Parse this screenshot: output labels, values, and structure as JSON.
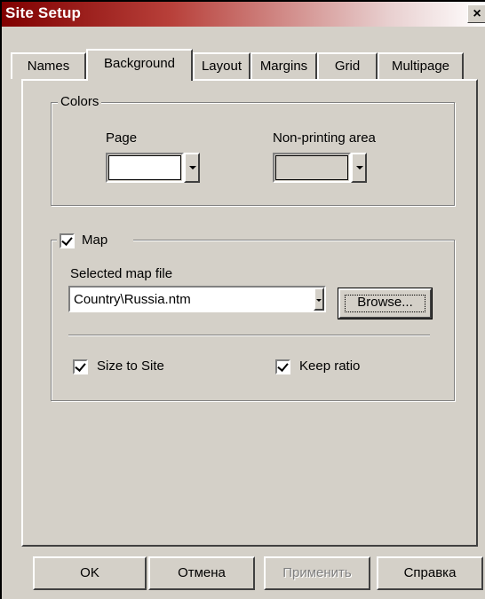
{
  "window": {
    "title": "Site Setup",
    "close_icon": "close-icon",
    "close_glyph": "×"
  },
  "tabs": [
    {
      "label": "Names",
      "active": false
    },
    {
      "label": "Background",
      "active": true
    },
    {
      "label": "Layout",
      "active": false
    },
    {
      "label": "Margins",
      "active": false
    },
    {
      "label": "Grid",
      "active": false
    },
    {
      "label": "Multipage",
      "active": false
    }
  ],
  "colors_group": {
    "title": "Colors",
    "page_label": "Page",
    "page_color": "#ffffff",
    "nonprint_label": "Non-printing area",
    "nonprint_color": "#d4d0c8"
  },
  "map_group": {
    "title": "Map",
    "checked": true,
    "selected_file_label": "Selected map file",
    "selected_file_value": "Country\\Russia.ntm",
    "browse_label": "Browse...",
    "size_to_site_label": "Size to Site",
    "size_to_site_checked": true,
    "keep_ratio_label": "Keep ratio",
    "keep_ratio_checked": true
  },
  "buttons": {
    "ok": "OK",
    "cancel": "Отмена",
    "apply": "Применить",
    "help": "Справка"
  }
}
